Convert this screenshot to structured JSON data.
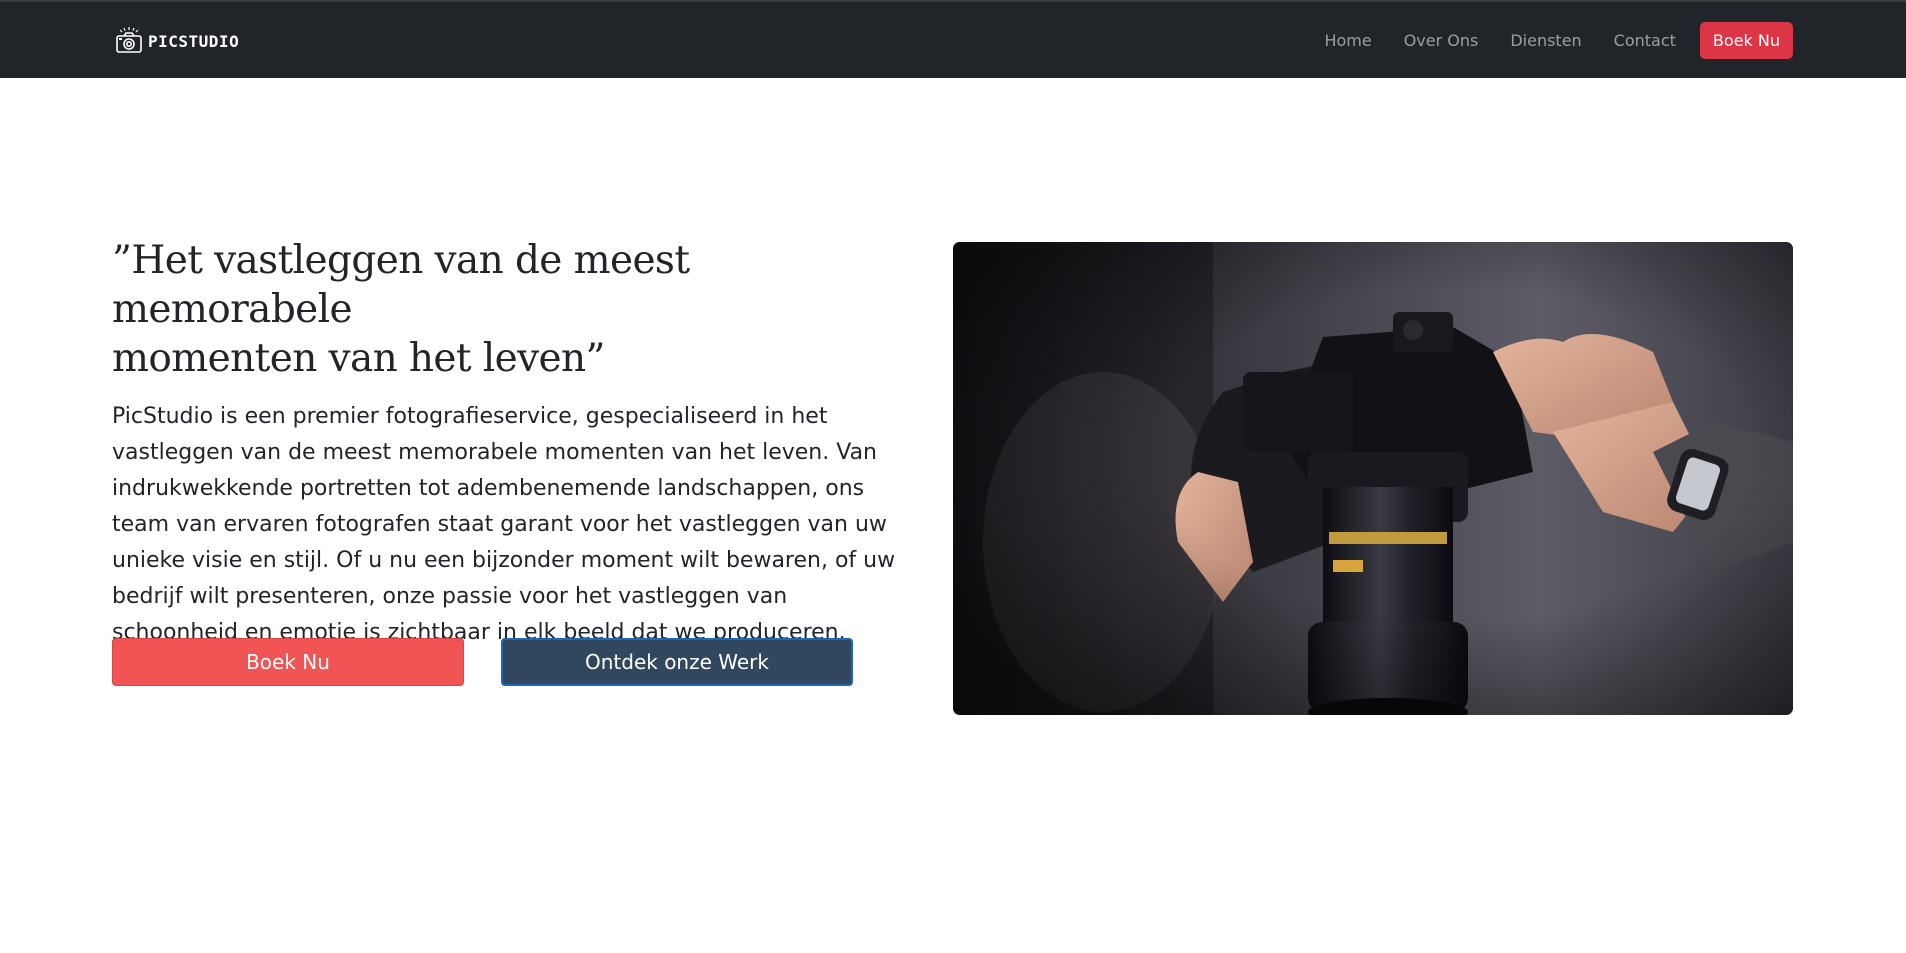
{
  "brand": {
    "name": "PICSTUDIO",
    "icon": "camera-icon"
  },
  "nav": {
    "items": [
      "Home",
      "Over Ons",
      "Diensten",
      "Contact"
    ],
    "cta_label": "Boek Nu"
  },
  "hero": {
    "headline_line1": "”Het vastleggen van de meest memorabele",
    "headline_line2": "momenten van het leven”",
    "description": "PicStudio is een premier fotografieservice, gespecialiseerd in het vastleggen van de meest memorabele momenten van het leven. Van indrukwekkende portretten tot adembenemende landschappen, ons team van ervaren fotografen staat garant voor het vastleggen van uw unieke visie en stijl. Of u nu een bijzonder moment wilt bewaren, of uw bedrijf wilt presenteren, onze passie voor het vastleggen van schoonheid en emotie is zichtbaar in elk beeld dat we produceren.",
    "primary_button": "Boek Nu",
    "secondary_button": "Ontdek onze Werk",
    "image_alt": "hands-holding-camera-photo"
  },
  "colors": {
    "navbar_bg": "#212529",
    "cta_red": "#dc3545",
    "primary_button": "#f05454",
    "secondary_button": "#30475e"
  }
}
